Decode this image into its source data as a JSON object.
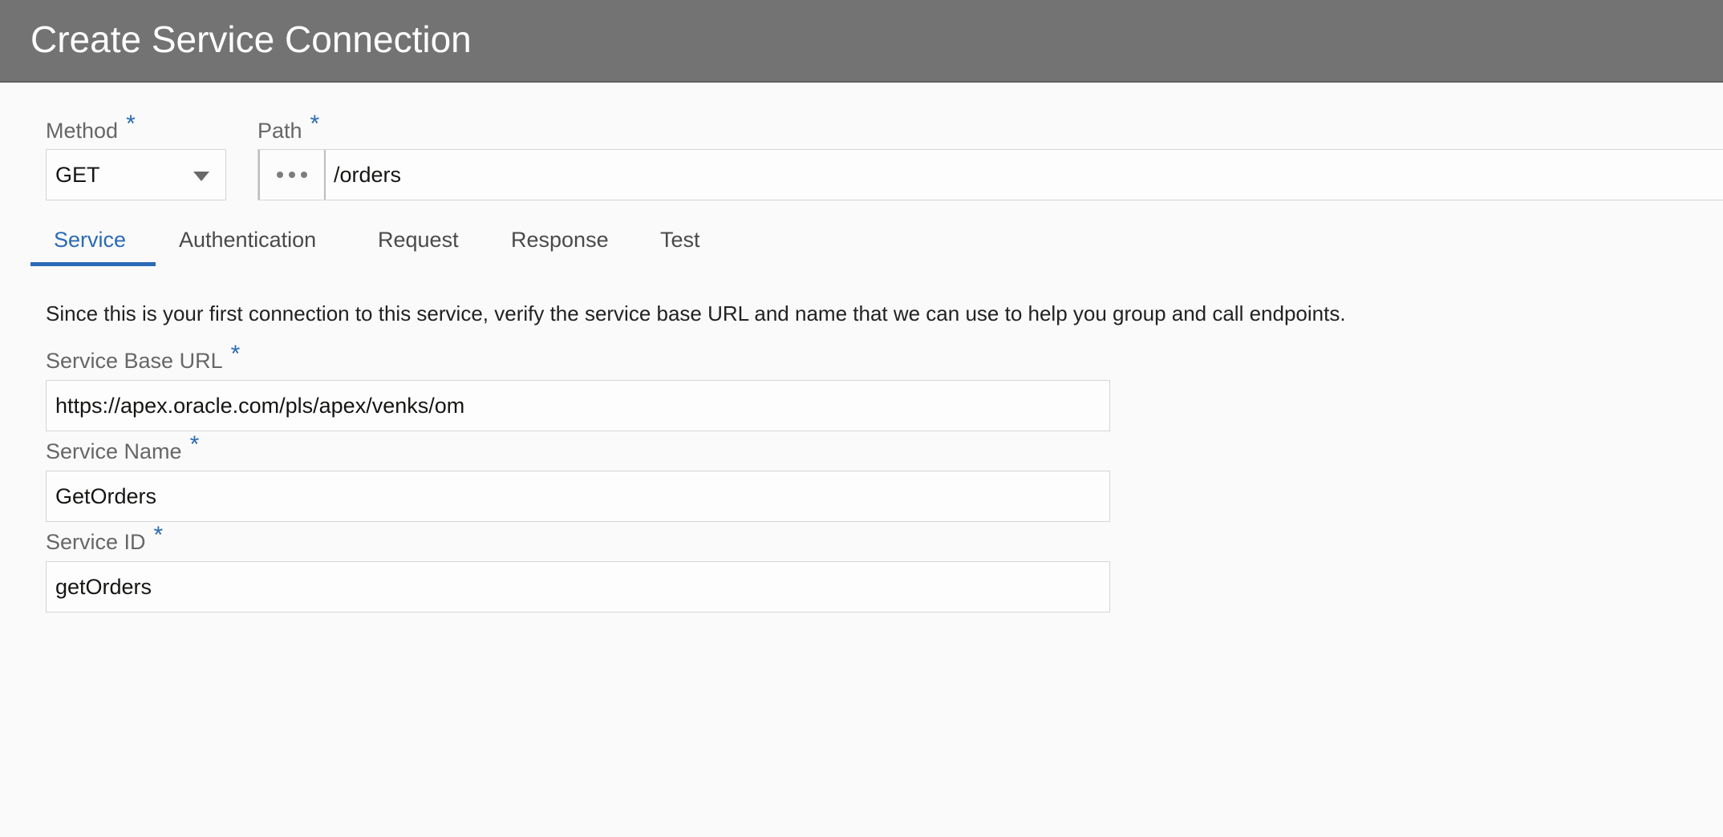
{
  "header": {
    "title": "Create Service Connection"
  },
  "method": {
    "label": "Method",
    "required_mark": "*",
    "value": "GET"
  },
  "path": {
    "label": "Path",
    "required_mark": "*",
    "value": "/orders"
  },
  "tabs": [
    {
      "label": "Service",
      "active": true
    },
    {
      "label": "Authentication",
      "active": false
    },
    {
      "label": "Request",
      "active": false
    },
    {
      "label": "Response",
      "active": false
    },
    {
      "label": "Test",
      "active": false
    }
  ],
  "service": {
    "intro": "Since this is your first connection to this service, verify the service base URL and name that we can use to help you group and call endpoints.",
    "base_url": {
      "label": "Service Base URL",
      "required_mark": "*",
      "value": "https://apex.oracle.com/pls/apex/venks/om"
    },
    "name": {
      "label": "Service Name",
      "required_mark": "*",
      "value": "GetOrders"
    },
    "id": {
      "label": "Service ID",
      "required_mark": "*",
      "value": "getOrders"
    }
  },
  "colors": {
    "header_bg": "#737373",
    "accent": "#2a6bb5",
    "page_bg": "#fafafa"
  },
  "icons": {
    "method_dropdown": "chevron-down-icon",
    "path_picker": "more-horizontal-icon"
  }
}
